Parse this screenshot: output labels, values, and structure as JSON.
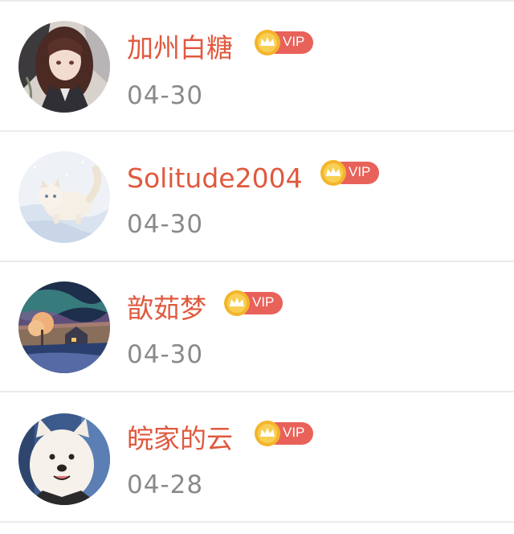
{
  "users": [
    {
      "name": "加州白糖",
      "date": "04-30",
      "badge": "VIP",
      "avatar": "anime-girl-avatar"
    },
    {
      "name": "Solitude2004",
      "date": "04-30",
      "badge": "VIP",
      "avatar": "white-cat-in-snow-avatar"
    },
    {
      "name": "歆茹梦",
      "date": "04-30",
      "badge": "VIP",
      "avatar": "aurora-night-house-avatar"
    },
    {
      "name": "皖家的云",
      "date": "04-28",
      "badge": "VIP",
      "avatar": "samoyed-dog-avatar"
    }
  ],
  "colors": {
    "name": "#e0593e",
    "date": "#8a8a8a",
    "vip_pill": "#e8625a",
    "crown_circle": "#f3b52b",
    "divider": "#ececec"
  }
}
